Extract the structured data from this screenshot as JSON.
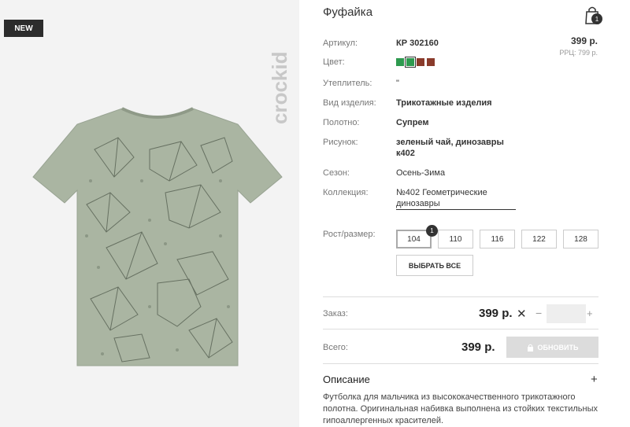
{
  "product": {
    "badge": "NEW",
    "brand": "crockid",
    "title": "Фуфайка",
    "cart_count": "1",
    "price": "399 р.",
    "rrp": "РРЦ: 799 р."
  },
  "attributes": {
    "sku": {
      "label": "Артикул:",
      "value": "КР 302160"
    },
    "color": {
      "label": "Цвет:"
    },
    "insulation": {
      "label": "Утеплитель:",
      "value": "\""
    },
    "type": {
      "label": "Вид изделия:",
      "value": "Трикотажные изделия"
    },
    "fabric": {
      "label": "Полотно:",
      "value": "Супрем"
    },
    "print": {
      "label": "Рисунок:",
      "value": "зеленый чай, динозавры",
      "value2": "к402"
    },
    "season": {
      "label": "Сезон:",
      "value": "Осень-Зима"
    },
    "collection": {
      "label": "Коллекция:",
      "value": "№402 Геометрические",
      "value2": "динозавры"
    }
  },
  "swatches": [
    {
      "color": "#2e9a4f",
      "selected": false
    },
    {
      "color": "#2e9a4f",
      "selected": true
    },
    {
      "color": "#8a3b2b",
      "selected": false
    },
    {
      "color": "#8a3b2b",
      "selected": false
    }
  ],
  "sizes": {
    "label": "Рост/размер:",
    "selected_count": "1",
    "options": [
      "104",
      "110",
      "116",
      "122",
      "128"
    ],
    "select_all": "ВЫБРАТЬ ВСЕ"
  },
  "order": {
    "label": "Заказ:",
    "price": "399 р.",
    "remove": "✕",
    "minus": "−",
    "plus": "+",
    "quantity": ""
  },
  "total": {
    "label": "Всего:",
    "price": "399 р.",
    "update_label": "ОБНОВИТЬ"
  },
  "description": {
    "title": "Описание",
    "toggle": "+",
    "text": "Футболка для мальчика из высококачественного трикотажного полотна. Оригинальная набивка выполнена из стойких текстильных гипоаллергенных красителей."
  }
}
